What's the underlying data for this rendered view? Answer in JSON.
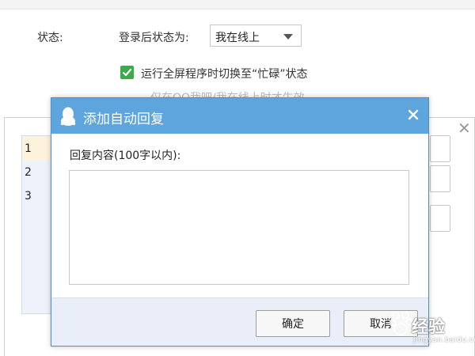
{
  "settings": {
    "status_label": "状态:",
    "after_login_label": "登录后状态为:",
    "status_selected": "我在线上",
    "fullscreen_busy_checked": true,
    "fullscreen_busy_label": "运行全屏程序时切换至“忙碌”状态",
    "partial_line": "仅在QQ我吧/我在线上时才生效"
  },
  "reply_list": {
    "rows": [
      "1",
      "2",
      "3"
    ],
    "selected_index": 0
  },
  "dialog": {
    "title": "添加自动回复",
    "content_label": "回复内容(100字以内):",
    "content_value": "",
    "ok_label": "确定",
    "cancel_label": "取消"
  },
  "watermark": {
    "brand": "经验",
    "sub": "jingyan.baidu.com"
  },
  "colors": {
    "header_blue": "#5ea5de",
    "check_green": "#3faa4b",
    "footer_bg": "#e9eef8"
  },
  "icons": {
    "qq": "qq-penguin-icon",
    "close": "close-icon",
    "dropdown": "chevron-down-icon",
    "check": "checkmark-icon"
  }
}
